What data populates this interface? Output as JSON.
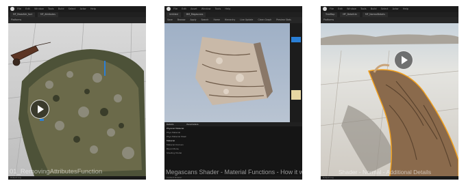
{
  "thumbnails": [
    {
      "menu": [
        "File",
        "Edit",
        "Window",
        "Tools",
        "Build",
        "Select",
        "Actor",
        "Help"
      ],
      "tabs": [
        "MF_MaskAttr_fact",
        "MF_Attributes"
      ],
      "toolbar": [
        "Platforms"
      ],
      "caption": "01_RemovingAttributesFunction",
      "status": "Output Log"
    },
    {
      "menu": [
        "File",
        "Edit",
        "Asset",
        "Window",
        "Tools",
        "Help"
      ],
      "tabs": [
        "Untitled",
        "MM_Megascans"
      ],
      "toolbar": [
        "Save",
        "Browse",
        "Apply",
        "Search",
        "Home",
        "Hierarchy",
        "Live Update",
        "Clean Graph",
        "Preview Stats"
      ],
      "panels": [
        "Details",
        "Parameters"
      ],
      "properties": [
        "Physical Material",
        "Phys Material",
        "Phys Material Mask",
        "Material",
        "Material Domain",
        "Blend Mode",
        "Shading Model"
      ],
      "caption": "Megascans Shader - Material Functions - How it works?",
      "status": "Content Drawer"
    },
    {
      "menu": [
        "File",
        "Edit",
        "Window",
        "Tools",
        "Build",
        "Select",
        "Actor",
        "Help"
      ],
      "tabs": [
        "TreeMap",
        "MF_DetailLtn",
        "MF_NormalDetails"
      ],
      "toolbar": [
        "Platforms"
      ],
      "caption": "Shader - Normal - Additional Details",
      "status": "Output Log"
    }
  ],
  "colors": {
    "editor_dark": "#1b1b1b",
    "accent_blue": "#2a7fd6",
    "highlight_orange": "#f0a020"
  }
}
